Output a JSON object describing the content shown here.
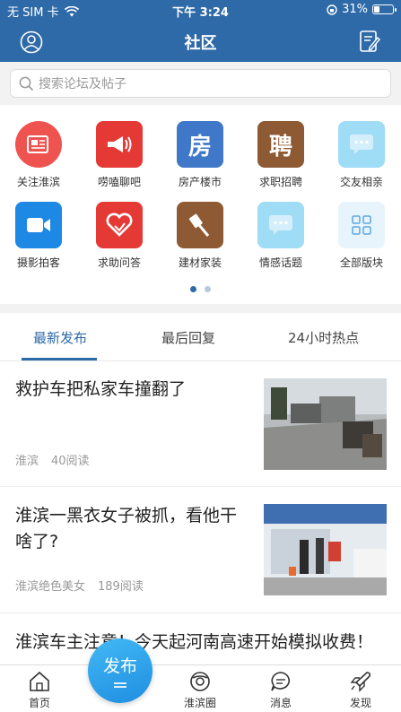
{
  "status_bar": {
    "carrier": "无 SIM 卡",
    "time": "下午 3:24",
    "battery": "31%",
    "battery_level": 0.31
  },
  "nav": {
    "title": "社区"
  },
  "search": {
    "placeholder": "搜索论坛及帖子"
  },
  "categories": [
    {
      "label": "关注淮滨",
      "icon": "newspaper-icon",
      "color": "#ef5350"
    },
    {
      "label": "唠嗑聊吧",
      "icon": "megaphone-icon",
      "color": "#e53935"
    },
    {
      "label": "房产楼市",
      "icon": "house-char-icon",
      "color": "#3f78c9"
    },
    {
      "label": "求职招聘",
      "icon": "hire-char-icon",
      "color": "#8d5a34"
    },
    {
      "label": "交友相亲",
      "icon": "chat-bubble-icon",
      "color": "#9fdcf5"
    },
    {
      "label": "摄影拍客",
      "icon": "video-camera-icon",
      "color": "#1e88e5"
    },
    {
      "label": "求助问答",
      "icon": "heart-icon",
      "color": "#e53935"
    },
    {
      "label": "建材家装",
      "icon": "brush-icon",
      "color": "#8d5a34"
    },
    {
      "label": "情感话题",
      "icon": "chat-bubble-icon",
      "color": "#9fdcf5"
    },
    {
      "label": "全部版块",
      "icon": "grid-icon",
      "color": "#e8f4fc"
    }
  ],
  "house_char": "房",
  "hire_char": "聘",
  "tabs": [
    "最新发布",
    "最后回复",
    "24小时热点"
  ],
  "posts": [
    {
      "title": "救护车把私家车撞翻了",
      "source": "淮滨",
      "reads": "40阅读"
    },
    {
      "title": "淮滨一黑衣女子被抓，看他干啥了?",
      "source": "淮滨绝色美女",
      "reads": "189阅读"
    },
    {
      "title": "淮滨车主注意！今天起河南高速开始模拟收费！"
    }
  ],
  "tabbar": {
    "home": "首页",
    "publish": "发布",
    "circle": "淮滨圈",
    "messages": "消息",
    "discover": "发现"
  },
  "colors": {
    "primary": "#2f6aa8",
    "publish": "#2a9ff0"
  }
}
